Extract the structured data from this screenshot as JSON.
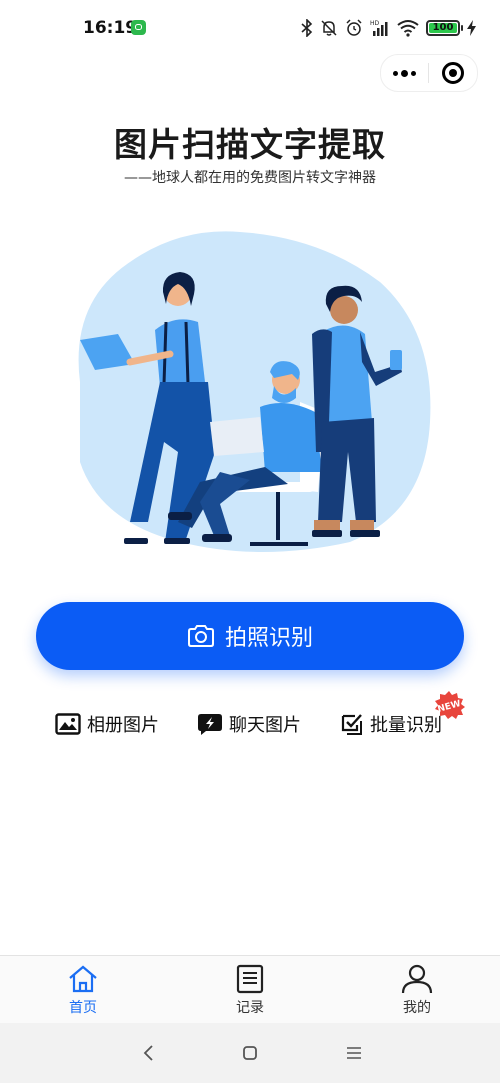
{
  "status_bar": {
    "time": "16:19",
    "battery": "100"
  },
  "header": {
    "title": "图片扫描文字提取",
    "subtitle": "——地球人都在用的免费图片转文字神器"
  },
  "hero": {
    "image": "illustration of three people working with laptops"
  },
  "actions": {
    "primary_label": "拍照识别",
    "options": [
      {
        "label": "相册图片",
        "icon": "image-icon"
      },
      {
        "label": "聊天图片",
        "icon": "lightning-chat-icon"
      },
      {
        "label": "批量识别",
        "icon": "batch-check-icon",
        "badge": "NEW"
      }
    ]
  },
  "tabbar": {
    "items": [
      {
        "label": "首页",
        "icon": "home-icon",
        "active": true
      },
      {
        "label": "记录",
        "icon": "document-icon",
        "active": false
      },
      {
        "label": "我的",
        "icon": "user-icon",
        "active": false
      }
    ]
  },
  "colors": {
    "primary": "#0b5cf5",
    "tab_active": "#1b6ef3",
    "badge": "#e8453c"
  }
}
